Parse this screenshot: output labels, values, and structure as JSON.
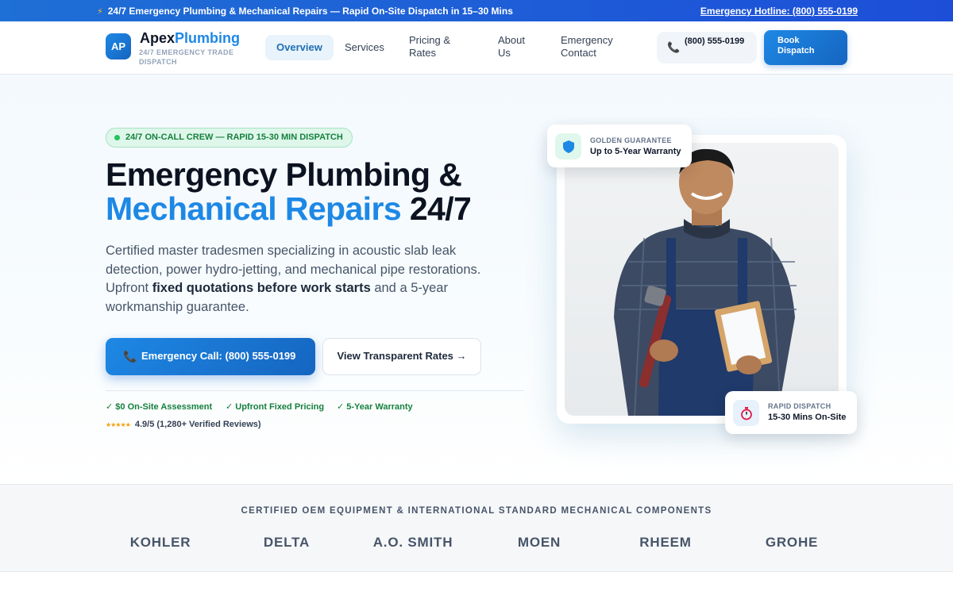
{
  "topbar": {
    "announcement": "24/7 Emergency Plumbing & Mechanical Repairs — Rapid On-Site Dispatch in 15–30 Mins",
    "hotline": "Emergency Hotline: (800) 555-0199"
  },
  "nav": {
    "logo_initials": "AP",
    "brand_part1": "Apex",
    "brand_part2": "Plumbing",
    "brand_tagline": "24/7 EMERGENCY TRADE DISPATCH",
    "links": [
      "Overview",
      "Services",
      "Pricing & Rates",
      "About Us",
      "Emergency Contact"
    ],
    "phone": "(800) 555-0199",
    "book_label": "Book Dispatch"
  },
  "hero": {
    "pill": "24/7 ON-CALL CREW — RAPID 15-30 MIN DISPATCH",
    "title_line1": "Emergency Plumbing &",
    "title_line2_blue": "Mechanical Repairs",
    "title_line2_rest": " 24/7",
    "desc_part1": "Certified master tradesmen specializing in acoustic slab leak detection, power hydro-jetting, and mechanical pipe restorations. Upfront ",
    "desc_bold": "fixed quotations before work starts",
    "desc_part2": " and a 5-year workmanship guarantee.",
    "cta_primary": "Emergency Call: (800) 555-0199",
    "cta_secondary": "View Transparent Rates →",
    "checks": [
      "✓  $0 On-Site Assessment",
      "✓  Upfront Fixed Pricing",
      "✓  5-Year Warranty"
    ],
    "stars": "★★★★★",
    "rating": "4.9/5 (1,280+ Verified Reviews)"
  },
  "badges": {
    "guarantee_label": "GOLDEN GUARANTEE",
    "guarantee_value": "Up to 5-Year Warranty",
    "dispatch_label": "RAPID DISPATCH",
    "dispatch_value": "15-30 Mins On-Site"
  },
  "brands": {
    "title": "CERTIFIED OEM EQUIPMENT & INTERNATIONAL STANDARD MECHANICAL COMPONENTS",
    "logos": [
      "KOHLER",
      "DELTA",
      "A.O. SMITH",
      "MOEN",
      "RHEEM",
      "GROHE"
    ]
  },
  "colors": {
    "primary": "#1e88e5",
    "accent_green": "#15803d",
    "topbar": "#1d4ed8"
  }
}
